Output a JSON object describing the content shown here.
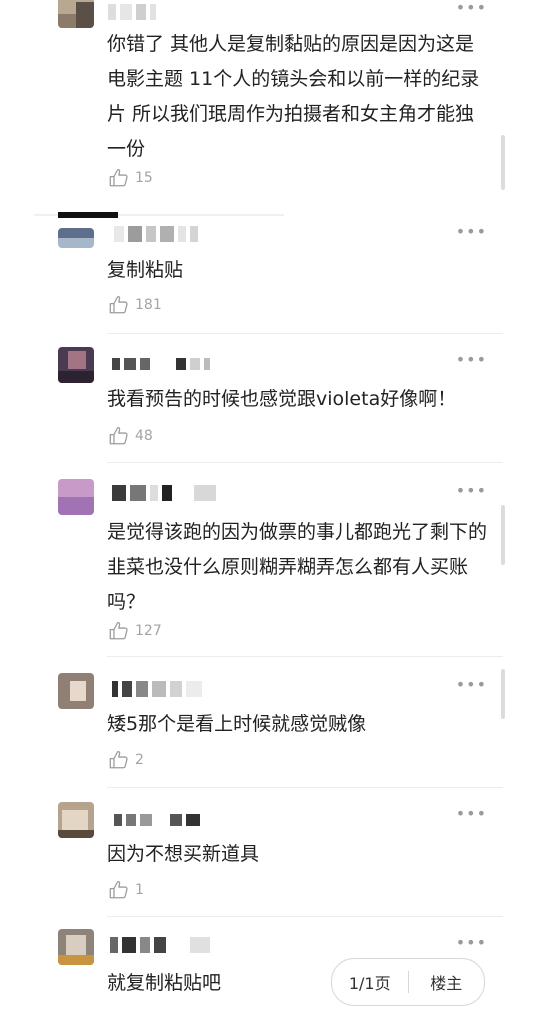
{
  "comments": [
    {
      "text": "你错了 其他人是复制黏贴的原因是因为这是电影主题 11个人的镜头会和以前一样的纪录片 所以我们珉周作为拍摄者和女主角才能独一份",
      "likes": "15"
    },
    {
      "text": "复制粘贴",
      "likes": "181"
    },
    {
      "text": "我看预告的时候也感觉跟violeta好像啊！",
      "likes": "48"
    },
    {
      "text": "是觉得该跑的因为做票的事儿都跑光了剩下的韭菜也没什么原则糊弄糊弄怎么都有人买账吗？",
      "likes": "127"
    },
    {
      "text": "矮5那个是看上时候就感觉贼像",
      "likes": "2"
    },
    {
      "text": "因为不想买新道具",
      "likes": "1"
    },
    {
      "text": "就复制粘贴吧",
      "likes": ""
    }
  ],
  "more_glyph": "•••",
  "pager": {
    "page_label": "1/1页",
    "op_label": "楼主"
  },
  "colors": {
    "accent_gray": "#a4a4a4",
    "divider": "#ececec"
  }
}
